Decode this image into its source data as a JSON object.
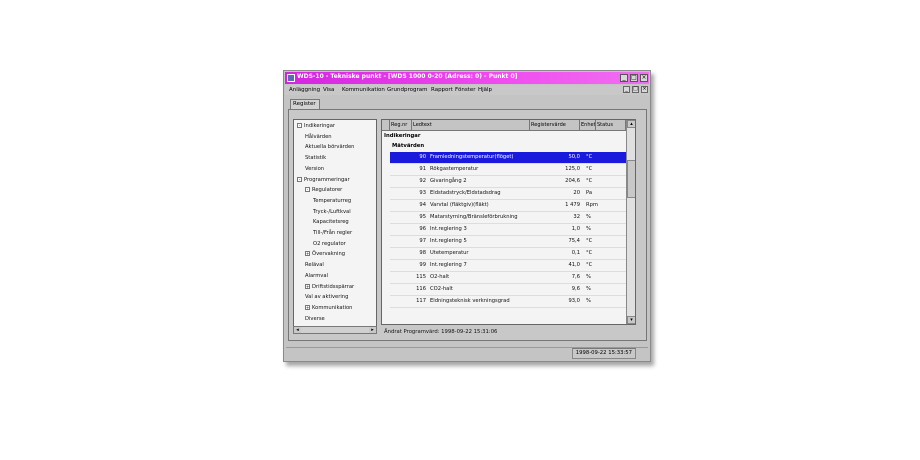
{
  "window": {
    "title": "WDS-10 - Tekniske punkt - [WDS 1000 0-20 (Adress: 0) - Punkt 0]",
    "minimize": "_",
    "maximize": "□",
    "close": "×"
  },
  "menu": [
    "Anläggning",
    "Visa",
    "Kommunikation",
    "Grundprogram",
    "Rapport",
    "Fönster",
    "Hjälp"
  ],
  "tab_label": "Register",
  "tree": [
    {
      "label": "Indikeringar",
      "level": 0,
      "exp": "-"
    },
    {
      "label": "Hålvärden",
      "level": 1
    },
    {
      "label": "Aktuella börvärden",
      "level": 1
    },
    {
      "label": "Statistik",
      "level": 1
    },
    {
      "label": "Version",
      "level": 1
    },
    {
      "label": "Programmeringar",
      "level": 0,
      "exp": "-"
    },
    {
      "label": "Regulatorer",
      "level": 1,
      "exp": "-"
    },
    {
      "label": "Temperaturreg",
      "level": 2
    },
    {
      "label": "Tryck-/Luftkval",
      "level": 2
    },
    {
      "label": "Kapacitetsreg",
      "level": 2
    },
    {
      "label": "Till-/Från regler",
      "level": 2
    },
    {
      "label": "O2 regulator",
      "level": 2
    },
    {
      "label": "Övervakning",
      "level": 1,
      "exp": "+"
    },
    {
      "label": "Reläval",
      "level": 1
    },
    {
      "label": "Alarmval",
      "level": 1
    },
    {
      "label": "Driftstidsspärrar",
      "level": 1,
      "exp": "+"
    },
    {
      "label": "Val av aktivering",
      "level": 1
    },
    {
      "label": "Kommunikation",
      "level": 1,
      "exp": "+"
    },
    {
      "label": "Diverse",
      "level": 1
    }
  ],
  "grid": {
    "columns": [
      "",
      "Reg.nr",
      "Ledtext",
      "Registervärde",
      "Enhet",
      "Status"
    ],
    "group": "Indikeringar",
    "subgroup": "Mätvärden",
    "rows": [
      {
        "nr": "90",
        "text": "Framledningstemperatur(flöget)",
        "value": "50,0",
        "unit": "°C",
        "selected": true
      },
      {
        "nr": "91",
        "text": "Rökgastemperatur",
        "value": "125,0",
        "unit": "°C"
      },
      {
        "nr": "92",
        "text": "Givaringång 2",
        "value": "204,6",
        "unit": "°C"
      },
      {
        "nr": "93",
        "text": "Eldstadstryck/Eldstadsdrag",
        "value": "20",
        "unit": "Pa"
      },
      {
        "nr": "94",
        "text": "Varvtal (fläktgiv)(fläkt)",
        "value": "1 479",
        "unit": "Rpm"
      },
      {
        "nr": "95",
        "text": "Matarstyrning/Bränsleförbrukning",
        "value": "32",
        "unit": "%"
      },
      {
        "nr": "96",
        "text": "Int.reglering 3",
        "value": "1,0",
        "unit": "%"
      },
      {
        "nr": "97",
        "text": "Int.reglering 5",
        "value": "75,4",
        "unit": "°C"
      },
      {
        "nr": "98",
        "text": "Utetemperatur",
        "value": "0,1",
        "unit": "°C"
      },
      {
        "nr": "99",
        "text": "Int.reglering 7",
        "value": "41,0",
        "unit": "°C"
      },
      {
        "nr": "115",
        "text": "O2-halt",
        "value": "7,6",
        "unit": "%"
      },
      {
        "nr": "116",
        "text": "CO2-halt",
        "value": "9,6",
        "unit": "%"
      },
      {
        "nr": "117",
        "text": "Eldningsteknisk verkningsgrad",
        "value": "93,0",
        "unit": "%"
      }
    ]
  },
  "info_bar": "Ändrat Programvärd:   1998-09-22 15:31:06",
  "status_bar": "1998-09-22 15:33:57"
}
